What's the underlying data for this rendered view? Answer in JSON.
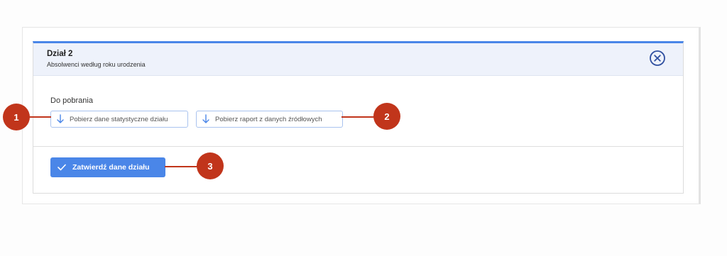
{
  "panel": {
    "title": "Dział 2",
    "subtitle": "Absolwenci według roku urodzenia",
    "close_icon": "close-circle-icon"
  },
  "downloads": {
    "label": "Do pobrania",
    "button_stats": "Pobierz dane statystyczne działu",
    "button_report": "Pobierz raport z danych źródłowych",
    "icon": "arrow-down-icon"
  },
  "actions": {
    "confirm_label": "Zatwierdź dane działu",
    "confirm_icon": "check-icon"
  },
  "callouts": {
    "one": "1",
    "two": "2",
    "three": "3"
  },
  "colors": {
    "accent": "#4a86e8",
    "header_bg": "#eef2fb",
    "callout": "#c1351b",
    "close_icon": "#2f4fa0"
  }
}
